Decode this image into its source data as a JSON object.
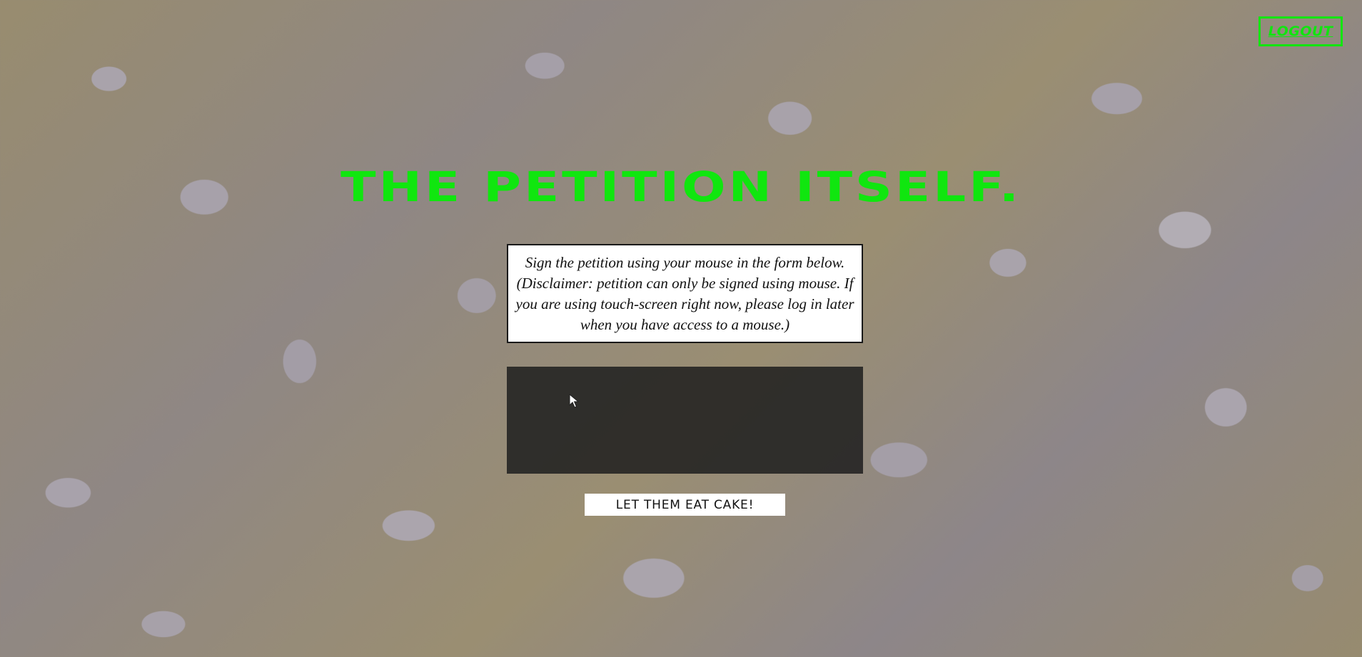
{
  "header": {
    "logout_label": "LOGOUT"
  },
  "main": {
    "title": "THE PETITION ITSELF.",
    "instructions": "Sign the petition using your mouse in the form below. (Disclaimer: petition can only be signed using mouse. If you are using touch-screen right now, please log in later when you have access to a mouse.)",
    "submit_label": "LET THEM EAT CAKE!"
  },
  "theme": {
    "accent": "#10e60f",
    "canvas_bg": "#1e1e1e",
    "button_bg": "#ffffff"
  },
  "icons": {
    "cursor": "mouse-pointer-icon"
  }
}
